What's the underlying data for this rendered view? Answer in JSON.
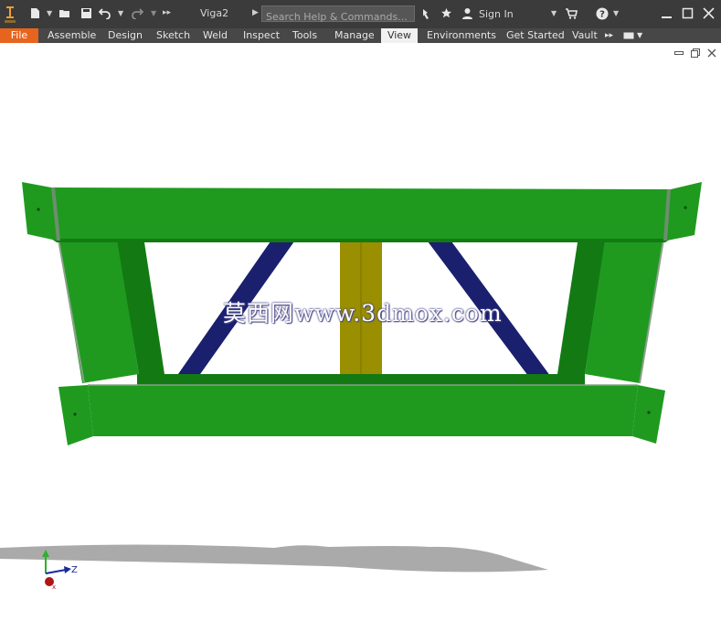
{
  "window": {
    "title": "Viga2",
    "search_placeholder": "Search Help & Commands...",
    "sign_in_label": "Sign In"
  },
  "ribbon": {
    "tabs": [
      {
        "label": "File"
      },
      {
        "label": "Assemble"
      },
      {
        "label": "Design"
      },
      {
        "label": "Sketch"
      },
      {
        "label": "Weld"
      },
      {
        "label": "Inspect"
      },
      {
        "label": "Tools"
      },
      {
        "label": "Manage"
      },
      {
        "label": "View",
        "active": true
      },
      {
        "label": "Environments"
      },
      {
        "label": "Get Started"
      },
      {
        "label": "Vault"
      }
    ]
  },
  "viewport": {
    "watermark": "莫西网www.3dmox.com",
    "triad_axis_label": "Z"
  },
  "colors": {
    "titlebar": "#3b3b3b",
    "file_tab": "#e6641e",
    "frame_green": "#1f9a1f",
    "brace_blue": "#1a1f6e",
    "post_olive": "#9a8f00"
  },
  "icons": [
    "app-logo-icon",
    "new-file-icon",
    "open-folder-icon",
    "save-icon",
    "undo-icon",
    "redo-icon",
    "search-icon",
    "star-icon",
    "user-icon",
    "cart-icon",
    "help-icon",
    "minimize-icon",
    "maximize-icon",
    "close-icon"
  ]
}
